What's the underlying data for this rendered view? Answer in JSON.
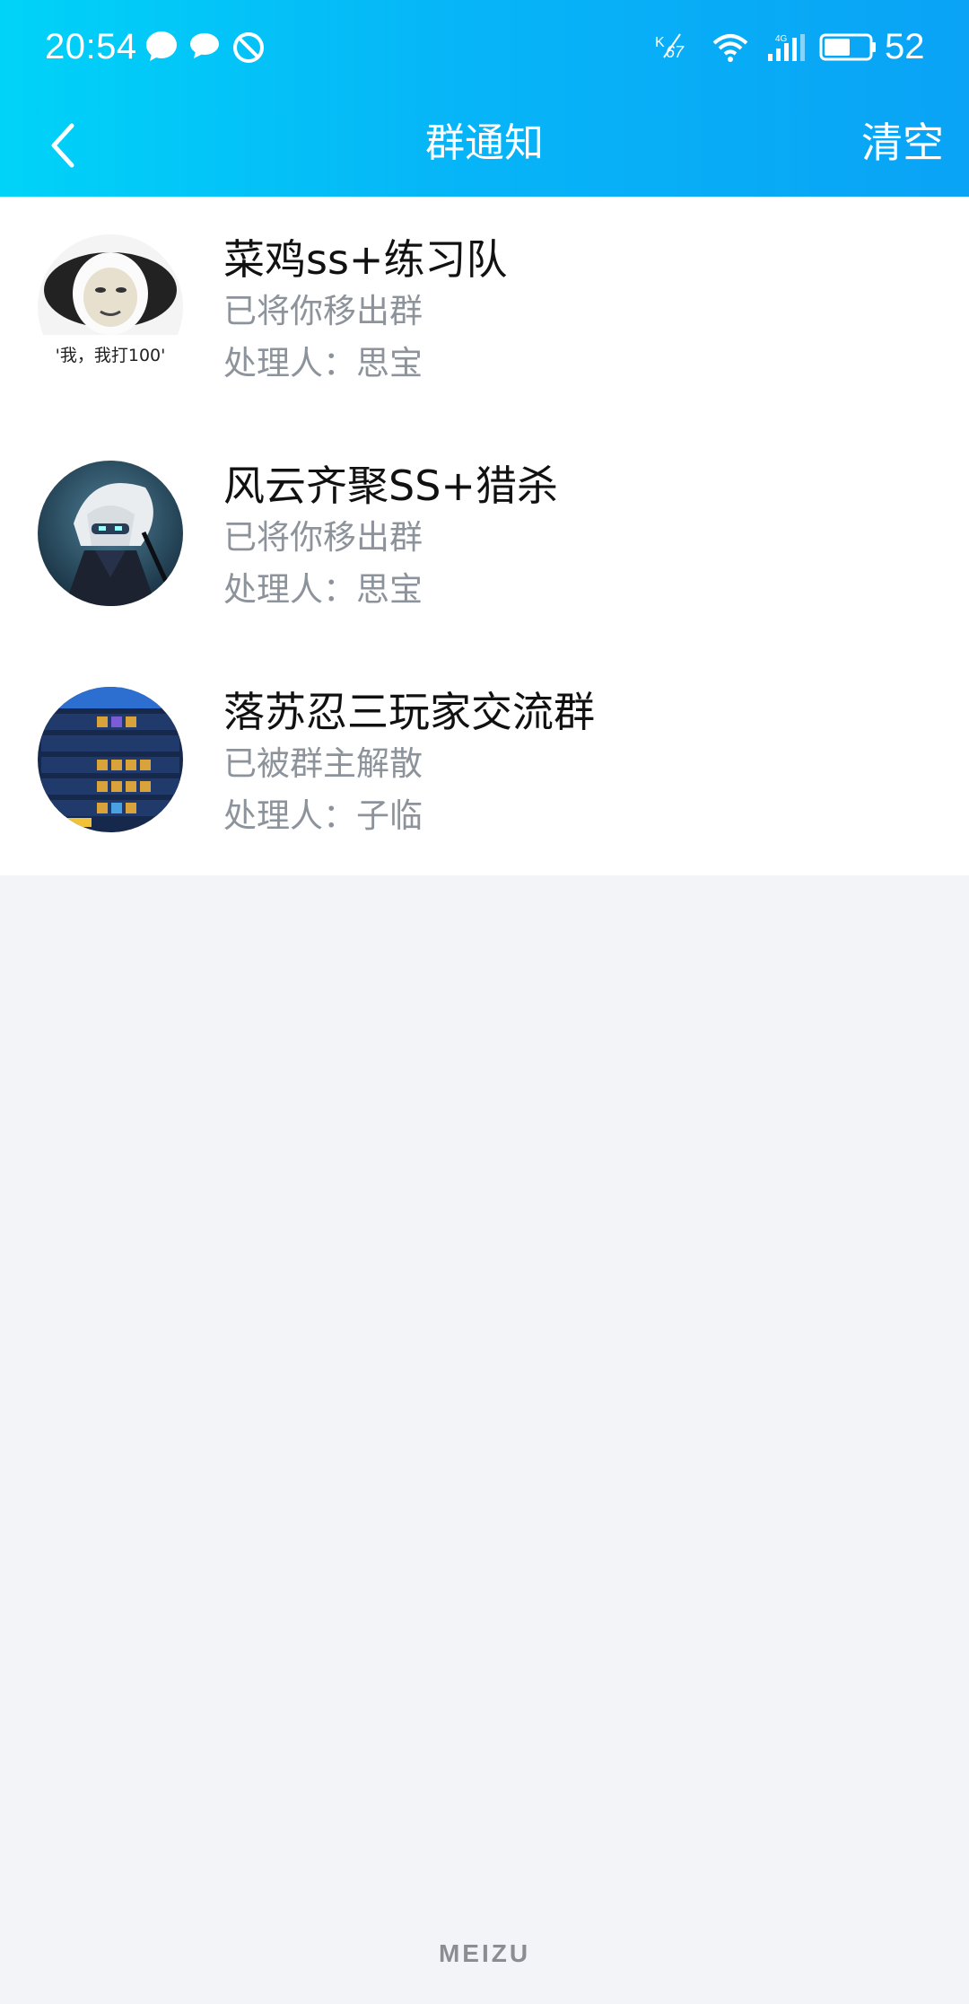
{
  "status_bar": {
    "time": "20:54",
    "battery": "52",
    "icons": [
      "chat-bubble-icon",
      "message-icon",
      "blocked-icon",
      "nfc-icon",
      "wifi-icon",
      "signal-icon",
      "battery-icon"
    ]
  },
  "header": {
    "title": "群通知",
    "clear_label": "清空",
    "back_icon": "chevron-left-icon"
  },
  "notifications": [
    {
      "group_name": "菜鸡ss+练习队",
      "status": "已将你移出群",
      "handler_prefix": "处理人：",
      "handler": "思宝",
      "avatar_caption": "'我，我打100'"
    },
    {
      "group_name": "风云齐聚SS+猎杀",
      "status": "已将你移出群",
      "handler_prefix": "处理人：",
      "handler": "思宝"
    },
    {
      "group_name": "落苏忍三玩家交流群",
      "status": "已被群主解散",
      "handler_prefix": "处理人：",
      "handler": "子临"
    }
  ],
  "footer": {
    "brand": "MEIZU"
  },
  "colors": {
    "header_start": "#00d3f8",
    "header_end": "#0aa3f6",
    "background": "#f2f4f8",
    "secondary_text": "#8d939b"
  }
}
